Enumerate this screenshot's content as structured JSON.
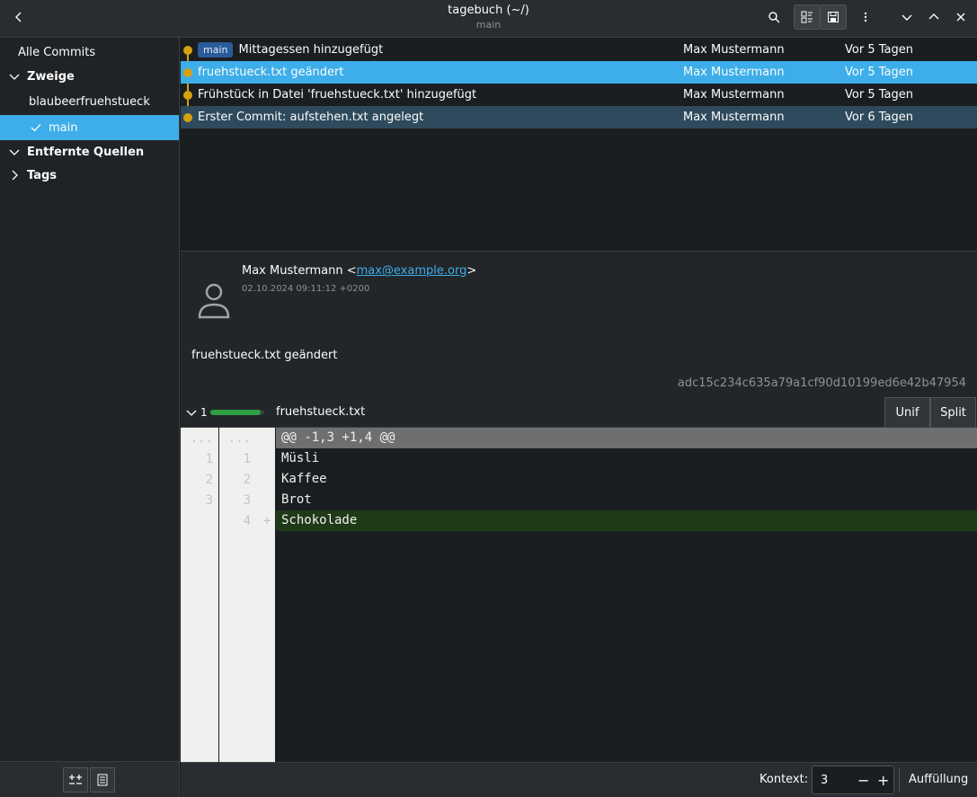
{
  "window": {
    "title": "tagebuch (~/)",
    "subtitle": "main"
  },
  "toolbar": {
    "back_icon": "chevron-left-icon",
    "search_icon": "search-icon",
    "view_icon": "list-view-icon",
    "save_icon": "save-icon",
    "menu_icon": "kebab-menu-icon",
    "down_icon": "chevron-down-icon",
    "up_icon": "chevron-up-icon"
  },
  "sidebar": {
    "all_commits": "Alle Commits",
    "branches_header": "Zweige",
    "branches": [
      {
        "label": "blaubeerfruehstueck",
        "checked": false
      },
      {
        "label": "main",
        "checked": true
      }
    ],
    "remotes_header": "Entfernte Quellen",
    "tags_header": "Tags"
  },
  "commits": [
    {
      "badge": "main",
      "message": "Mittagessen hinzugefügt",
      "author": "Max Mustermann",
      "date": "Vor 5 Tagen",
      "state": "normal"
    },
    {
      "badge": "",
      "message": "fruehstueck.txt geändert",
      "author": "Max Mustermann",
      "date": "Vor 5 Tagen",
      "state": "selected"
    },
    {
      "badge": "",
      "message": "Frühstück in Datei 'fruehstueck.txt' hinzugefügt",
      "author": "Max Mustermann",
      "date": "Vor 5 Tagen",
      "state": "normal"
    },
    {
      "badge": "",
      "message": "Erster Commit: aufstehen.txt angelegt",
      "author": "Max Mustermann",
      "date": "Vor 6 Tagen",
      "state": "current"
    }
  ],
  "details": {
    "author_name": "Max Mustermann <",
    "author_email": "max@example.org",
    "author_suffix": ">",
    "date": "02.10.2024 09:11:12 +0200",
    "message": "fruehstueck.txt geändert",
    "hash": "adc15c234c635a79a1cf90d10199ed6e42b47954"
  },
  "file": {
    "change_count": "1",
    "change_fraction": 1.0,
    "name": "fruehstueck.txt",
    "view_unified": "Unif",
    "view_split": "Split"
  },
  "diff": [
    {
      "kind": "hunk",
      "old": "...",
      "new": "...",
      "marker": "",
      "text": "@@ -1,3 +1,4 @@"
    },
    {
      "kind": "context",
      "old": "1",
      "new": "1",
      "marker": "",
      "text": "Müsli"
    },
    {
      "kind": "context",
      "old": "2",
      "new": "2",
      "marker": "",
      "text": "Kaffee"
    },
    {
      "kind": "context",
      "old": "3",
      "new": "3",
      "marker": "",
      "text": "Brot"
    },
    {
      "kind": "add",
      "old": "",
      "new": "4",
      "marker": "+",
      "text": "Schokolade"
    }
  ],
  "statusbar": {
    "context_label": "Kontext:",
    "context_value": "3",
    "minus": "−",
    "plus": "+",
    "fill_label": "Auffüllung"
  },
  "colors": {
    "accent": "#3daee9",
    "graph": "#d4a20f",
    "added": "#1f3a17",
    "badge": "#2a5b9a"
  }
}
